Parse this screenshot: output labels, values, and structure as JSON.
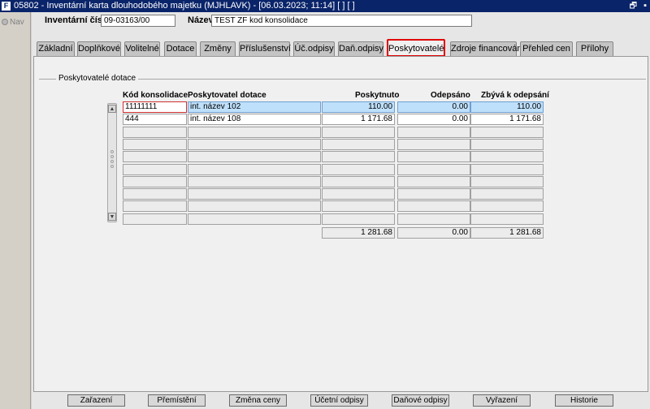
{
  "window": {
    "title": "05802 - Inventární karta dlouhodobého majetku (MJHLAVK) - [06.03.2023; 11:14]  [ ]  [ ]",
    "app_icon": "form-icon",
    "restore_glyph": "🗗",
    "close_glyph": "▪"
  },
  "nav": {
    "label": "Nav",
    "icon": "nav-icon"
  },
  "header": {
    "inv_label": "Inventární číslo",
    "inv_value": "09-03163/00",
    "name_label": "Název",
    "name_value": "TEST ZF kod konsolidace"
  },
  "tabs": [
    "Základní",
    "Doplňkové",
    "Volitelné",
    "Dotace",
    "Změny",
    "Příslušenství",
    "Úč.odpisy",
    "Daň.odpisy",
    "Poskytovatelé",
    "Zdroje financování",
    "Přehled cen",
    "Přílohy"
  ],
  "active_tab": "Poskytovatelé",
  "group": {
    "title": "Poskytovatelé dotace"
  },
  "table": {
    "columns": [
      "Kód konsolidace",
      "Poskytovatel dotace",
      "Poskytnuto",
      "Odepsáno",
      "Zbývá k odepsání"
    ],
    "rows": [
      [
        "11111111",
        "int. název 102",
        "110.00",
        "0.00",
        "110.00"
      ],
      [
        "444",
        "int. název 108",
        "1 171.68",
        "0.00",
        "1 171.68"
      ],
      [
        "",
        "",
        "",
        "",
        ""
      ],
      [
        "",
        "",
        "",
        "",
        ""
      ],
      [
        "",
        "",
        "",
        "",
        ""
      ],
      [
        "",
        "",
        "",
        "",
        ""
      ],
      [
        "",
        "",
        "",
        "",
        ""
      ],
      [
        "",
        "",
        "",
        "",
        ""
      ],
      [
        "",
        "",
        "",
        "",
        ""
      ],
      [
        "",
        "",
        "",
        "",
        ""
      ]
    ],
    "totals": [
      "1 281.68",
      "0.00",
      "1 281.68"
    ]
  },
  "scrollbar": {
    "up_glyph": "▲",
    "down_glyph": "▼"
  },
  "buttons": [
    "Zařazení",
    "Přemístění",
    "Změna ceny",
    "Účetní odpisy",
    "Daňové odpisy",
    "Vyřazení",
    "Historie"
  ]
}
